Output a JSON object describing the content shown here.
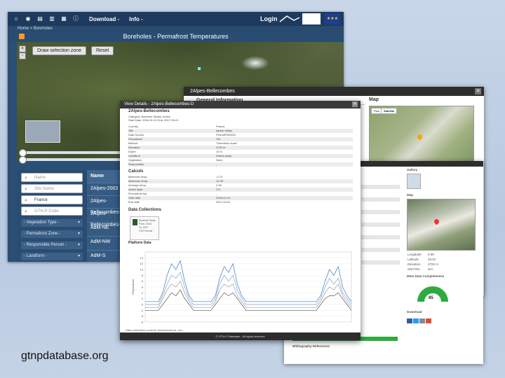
{
  "main_window": {
    "nav": {
      "download": "Download -",
      "info": "Info -",
      "login": "Login"
    },
    "breadcrumb": "Home > Boreholes",
    "title": "Boreholes - Permafrost Temperatures",
    "map": {
      "draw_button": "Draw selection zone",
      "reset_button": "Reset",
      "zoom_in": "+",
      "zoom_out": "-"
    },
    "filters": {
      "inputs": [
        {
          "placeholder": "Name"
        },
        {
          "placeholder": "Site Name"
        },
        {
          "value": "France"
        },
        {
          "placeholder": "GTN-P Code"
        }
      ],
      "selects": [
        "- Vegetation Type -",
        "- Permafrost Zone -",
        "- Responsible Person -",
        "- Landform -"
      ]
    },
    "results": {
      "header": "Name",
      "rows": [
        "2Alpes-2003",
        "2Alpes-Bellecombes-D",
        "2Alpes-Bellecombes-C",
        "AdM-NE",
        "AdM-NW",
        "AdM-S"
      ]
    }
  },
  "window_b": {
    "title": "2Alpes-Bellecombes",
    "general_info": "General Information",
    "map_label": "Map",
    "map_tabs": [
      "Plan",
      "Satellite"
    ],
    "table_header": "Coordinates"
  },
  "window_c": {
    "metadata_title": "Meta Data Completeness",
    "gauge_value": "85",
    "download_title": "Download",
    "references_title": "Bibliography References",
    "gallery": "Gallery",
    "map_label": "Map",
    "info_rows": [
      [
        "Longitude",
        "6.09"
      ],
      [
        "Latitude",
        "45.04"
      ],
      [
        "Elevation",
        "2700 m"
      ],
      [
        "SNOTEL",
        "N/A"
      ]
    ]
  },
  "popup": {
    "header": "View Details - 2Alpes-Bellecombes-D",
    "site_name": "2Alpes-Bellecombes",
    "summary_lines": [
      "Category: Borehole  Status: Active",
      "Start Date: 2016-01-01  End: 2017-09-01"
    ],
    "properties": [
      [
        "Country",
        "France"
      ],
      [
        "Site",
        "Alpine Valley"
      ],
      [
        "Data Source",
        "PermaFRANCE"
      ],
      [
        "Permafrost",
        "Yes"
      ],
      [
        "Method",
        "Thermistor chain"
      ],
      [
        "Elevation",
        "2700 m"
      ],
      [
        "Depth",
        "10 m"
      ],
      [
        "Landform",
        "Debris slope"
      ],
      [
        "Vegetation",
        "None"
      ],
      [
        "Responsible",
        "-"
      ]
    ],
    "calculated_title": "Calculs",
    "calculated": [
      [
        "Minimum temp.",
        "-0.73"
      ],
      [
        "Maximum temp.",
        "12.35"
      ],
      [
        "Average temp.",
        "2.08"
      ],
      [
        "Active layer",
        "2.8"
      ],
      [
        "Permafrost top",
        "-"
      ],
      [
        "Start date",
        "2016-01-01"
      ],
      [
        "End date",
        "2017-09-01"
      ]
    ],
    "data_collections_title": "Data Collections",
    "dl_lines": [
      "Borehole Temp.",
      "From: 2016",
      "To: 2017",
      "CSV Format"
    ],
    "platform_title": "Platform Data",
    "footer_note": "Data collections could be downloaded as .csv",
    "footer": "© GTN-P Database - All rights reserved"
  },
  "chart_data": {
    "type": "line",
    "title": "",
    "xlabel": "",
    "ylabel": "Temperature",
    "ylim": [
      -8,
      16
    ],
    "y_ticks": [
      -8,
      -6,
      -4,
      -2,
      0,
      2,
      4,
      6,
      8,
      10,
      12,
      14
    ],
    "x": [
      0,
      1,
      2,
      3,
      4,
      5,
      6,
      7,
      8,
      9,
      10,
      11,
      12,
      13,
      14,
      15,
      16,
      17,
      18,
      19,
      20,
      21,
      22,
      23,
      24,
      25,
      26,
      27,
      28,
      29,
      30,
      31,
      32,
      33,
      34,
      35,
      36,
      37,
      38,
      39,
      40,
      41,
      42,
      43,
      44,
      45,
      46,
      47
    ],
    "series": [
      {
        "color": "#3a78c2",
        "values": [
          -1,
          -1,
          -1,
          -1,
          2,
          8,
          12,
          10,
          13,
          6,
          1,
          -1,
          -1,
          -1,
          -1,
          -1,
          1,
          7,
          11,
          9,
          12,
          5,
          1,
          -1,
          -1,
          -1,
          -1,
          -1,
          -1,
          -1,
          -1,
          -1,
          -1,
          -1,
          -1,
          -1,
          -1,
          -1,
          -1,
          -1,
          1,
          6,
          10,
          8,
          11,
          4,
          1,
          -1
        ]
      },
      {
        "color": "#7aa6d6",
        "values": [
          -2,
          -2,
          -2,
          -2,
          1,
          5,
          8,
          7,
          9,
          4,
          0,
          -2,
          -2,
          -2,
          -2,
          -2,
          0,
          5,
          8,
          6,
          8,
          3,
          0,
          -2,
          -2,
          -2,
          -2,
          -2,
          -2,
          -2,
          -2,
          -2,
          -2,
          -2,
          -2,
          -2,
          -2,
          -2,
          -2,
          -2,
          0,
          4,
          7,
          5,
          7,
          2,
          0,
          -2
        ]
      },
      {
        "color": "#9a9a9a",
        "values": [
          -3,
          -3,
          -3,
          -3,
          0,
          3,
          5,
          4,
          6,
          2,
          -1,
          -3,
          -3,
          -3,
          -3,
          -3,
          -1,
          3,
          5,
          4,
          5,
          1,
          -1,
          -3,
          -3,
          -3,
          -3,
          -3,
          -3,
          -3,
          -3,
          -3,
          -3,
          -3,
          -3,
          -3,
          -3,
          -3,
          -3,
          -3,
          -1,
          2,
          4,
          3,
          5,
          1,
          -1,
          -3
        ]
      },
      {
        "color": "#555555",
        "values": [
          -4,
          -4,
          -4,
          -4,
          -2,
          0,
          2,
          1,
          3,
          0,
          -2,
          -4,
          -4,
          -4,
          -4,
          -4,
          -2,
          0,
          2,
          1,
          2,
          0,
          -2,
          -4,
          -4,
          -4,
          -4,
          -4,
          -4,
          -4,
          -4,
          -4,
          -4,
          -4,
          -4,
          -4,
          -4,
          -4,
          -4,
          -4,
          -2,
          0,
          1,
          1,
          2,
          0,
          -2,
          -4
        ]
      }
    ]
  },
  "caption": "gtnpdatabase.org"
}
